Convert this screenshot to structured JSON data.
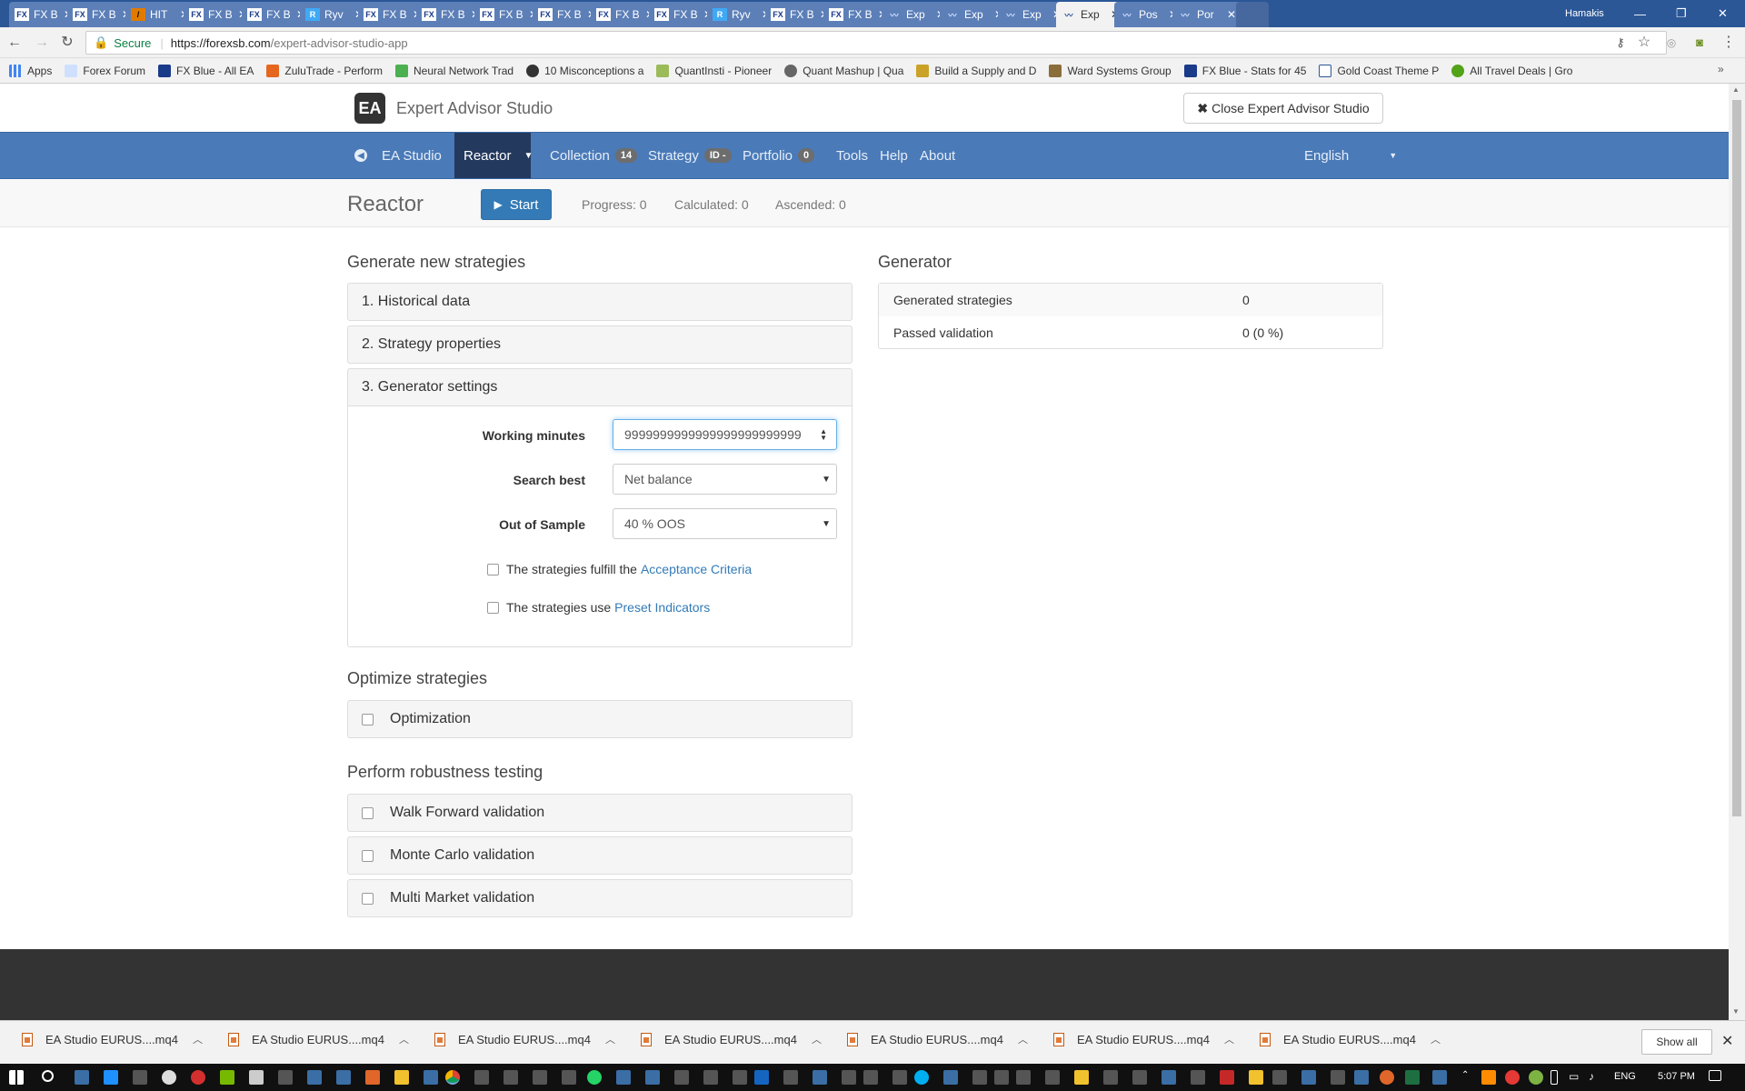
{
  "browser": {
    "tabs": [
      {
        "label": "FX B",
        "icon": "fx-blue-icon",
        "active": false
      },
      {
        "label": "FX B",
        "icon": "fx-blue-icon",
        "active": false
      },
      {
        "label": "HIT",
        "icon": "hit-icon",
        "active": false
      },
      {
        "label": "FX B",
        "icon": "fx-blue-icon",
        "active": false
      },
      {
        "label": "FX B",
        "icon": "fx-blue-icon",
        "active": false
      },
      {
        "label": "Ryv",
        "icon": "ryv-icon",
        "active": false
      },
      {
        "label": "FX B",
        "icon": "fx-blue-icon",
        "active": false
      },
      {
        "label": "FX B",
        "icon": "fx-blue-icon",
        "active": false
      },
      {
        "label": "FX B",
        "icon": "fx-blue-icon",
        "active": false
      },
      {
        "label": "FX B",
        "icon": "fx-blue-icon",
        "active": false
      },
      {
        "label": "FX B",
        "icon": "fx-blue-icon",
        "active": false
      },
      {
        "label": "FX B",
        "icon": "fx-blue-icon",
        "active": false
      },
      {
        "label": "Ryv",
        "icon": "ryv-icon",
        "active": false
      },
      {
        "label": "FX B",
        "icon": "fx-blue-icon",
        "active": false
      },
      {
        "label": "FX B",
        "icon": "fx-blue-icon",
        "active": false
      },
      {
        "label": "Exp",
        "icon": "forexsb-icon",
        "active": false
      },
      {
        "label": "Exp",
        "icon": "forexsb-icon",
        "active": false
      },
      {
        "label": "Exp",
        "icon": "forexsb-icon",
        "active": false
      },
      {
        "label": "Exp",
        "icon": "forexsb-icon",
        "active": true
      },
      {
        "label": "Pos",
        "icon": "forexsb-icon",
        "active": false
      },
      {
        "label": "Por",
        "icon": "forexsb-icon",
        "active": false
      }
    ],
    "user_label": "Hamakis",
    "secure_label": "Secure",
    "url_host": "https://forexsb.com",
    "url_path": "/expert-advisor-studio-app",
    "apps_label": "Apps",
    "bookmarks": [
      "Forex Forum",
      "FX Blue - All EA",
      "ZuluTrade - Perform",
      "Neural Network Trad",
      "10 Misconceptions a",
      "QuantInsti - Pioneer",
      "Quant Mashup | Qua",
      "Build a Supply and D",
      "Ward Systems Group",
      "FX Blue - Stats for 45",
      "Gold Coast Theme P",
      "All Travel Deals | Gro"
    ]
  },
  "header": {
    "brand_logo": "EA",
    "brand_name": "Expert Advisor Studio",
    "close_button": "Close Expert Advisor Studio"
  },
  "nav": {
    "items": [
      {
        "label": "EA Studio"
      },
      {
        "label": "Reactor"
      },
      {
        "label": "Collection",
        "badge": "14"
      },
      {
        "label": "Strategy",
        "badge": "ID -"
      },
      {
        "label": "Portfolio",
        "badge": "0"
      },
      {
        "label": "Tools"
      },
      {
        "label": "Help"
      },
      {
        "label": "About"
      }
    ],
    "language": "English"
  },
  "subbar": {
    "title": "Reactor",
    "start_label": "Start",
    "progress": "Progress: 0",
    "calculated": "Calculated: 0",
    "ascended": "Ascended: 0"
  },
  "generate": {
    "heading": "Generate new strategies",
    "panels": [
      "1. Historical data",
      "2. Strategy properties",
      "3. Generator settings"
    ],
    "working_minutes_label": "Working minutes",
    "working_minutes_value": "9999999999999999999999999",
    "search_best_label": "Search best",
    "search_best_value": "Net balance",
    "oos_label": "Out of Sample",
    "oos_value": "40 % OOS",
    "acceptance_text": "The strategies fulfill the",
    "acceptance_link": "Acceptance Criteria",
    "preset_text": "The strategies use",
    "preset_link": "Preset Indicators"
  },
  "optimize": {
    "heading": "Optimize strategies",
    "optimization_label": "Optimization"
  },
  "robustness": {
    "heading": "Perform robustness testing",
    "items": [
      "Walk Forward validation",
      "Monte Carlo validation",
      "Multi Market validation"
    ]
  },
  "generator": {
    "heading": "Generator",
    "rows": [
      {
        "key": "Generated strategies",
        "value": "0"
      },
      {
        "key": "Passed validation",
        "value": "0 (0 %)"
      }
    ]
  },
  "downloads": {
    "items": [
      "EA Studio EURUS....mq4",
      "EA Studio EURUS....mq4",
      "EA Studio EURUS....mq4",
      "EA Studio EURUS....mq4",
      "EA Studio EURUS....mq4",
      "EA Studio EURUS....mq4",
      "EA Studio EURUS....mq4"
    ],
    "show_all": "Show all"
  },
  "taskbar": {
    "language": "ENG",
    "time": "5:07 PM"
  },
  "colors": {
    "navbar": "#4a7ab8",
    "nav_active": "#23395d",
    "primary_button": "#337ab7",
    "link": "#337ab7",
    "footer": "#333333"
  }
}
